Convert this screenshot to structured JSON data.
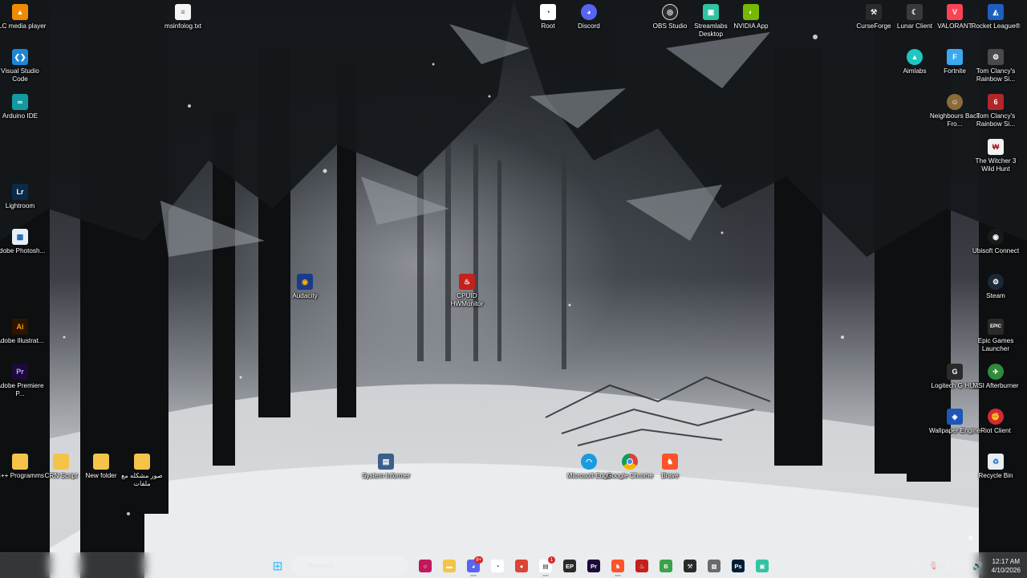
{
  "desktop": {
    "icons": [
      {
        "label": "VLC media player",
        "icon": "vlc-icon",
        "color": "#f08a00",
        "glyph": "▲"
      },
      {
        "label": "Visual Studio Code",
        "icon": "vscode-icon",
        "color": "#1f86d6",
        "glyph": "❮❯"
      },
      {
        "label": "Arduino IDE",
        "icon": "arduino-icon",
        "color": "#129aa0",
        "glyph": "∞"
      },
      {
        "label": "Lightroom",
        "icon": "lightroom-icon",
        "color": "#0b2a4a",
        "glyph": "Lr"
      },
      {
        "label": "Adobe Photosh...",
        "icon": "photoshop-icon",
        "color": "#e8eef5",
        "glyph": "▦"
      },
      {
        "label": "Adobe Illustrat...",
        "icon": "illustrator-icon",
        "color": "#2b1500",
        "glyph": "Ai"
      },
      {
        "label": "Adobe Premiere P...",
        "icon": "premiere-icon",
        "color": "#1b0a3a",
        "glyph": "Pr"
      },
      {
        "label": "C++ Programms",
        "icon": "folder-icon",
        "color": "#f3c449",
        "glyph": ""
      },
      {
        "label": "CRN Script",
        "icon": "folder-icon",
        "color": "#f3c449",
        "glyph": ""
      },
      {
        "label": "New folder",
        "icon": "folder-icon",
        "color": "#f3c449",
        "glyph": ""
      },
      {
        "label": "صور مشكله مع ملفات",
        "icon": "folder-icon",
        "color": "#f3c449",
        "glyph": ""
      },
      {
        "label": "msinfolog.txt",
        "icon": "text-file-icon",
        "color": "#f4f4f4",
        "glyph": "≡"
      },
      {
        "label": "Audacity",
        "icon": "audacity-icon",
        "color": "#1a3a8a",
        "glyph": "◉"
      },
      {
        "label": "CPUID HWMonitor",
        "icon": "hwmonitor-icon",
        "color": "#c4201c",
        "glyph": "♨"
      },
      {
        "label": "System Informer",
        "icon": "system-informer-icon",
        "color": "#3a5f8a",
        "glyph": "▤"
      },
      {
        "label": "Root",
        "icon": "root-icon",
        "color": "#ffffff",
        "glyph": "◔"
      },
      {
        "label": "Discord",
        "icon": "discord-icon",
        "color": "#5865f2",
        "glyph": "◕"
      },
      {
        "label": "OBS Studio",
        "icon": "obs-icon",
        "color": "#2b2b2b",
        "glyph": "◎"
      },
      {
        "label": "Streamlabs Desktop",
        "icon": "streamlabs-icon",
        "color": "#31c3a2",
        "glyph": "▣"
      },
      {
        "label": "NVIDIA App",
        "icon": "nvidia-icon",
        "color": "#76b900",
        "glyph": "◐"
      },
      {
        "label": "Microsoft Edge",
        "icon": "edge-icon",
        "color": "#1a9be0",
        "glyph": "◠"
      },
      {
        "label": "Google Chrome",
        "icon": "chrome-icon",
        "color": "#db4437",
        "glyph": "●"
      },
      {
        "label": "Brave",
        "icon": "brave-icon",
        "color": "#fb542b",
        "glyph": "♞"
      },
      {
        "label": "CurseForge",
        "icon": "curseforge-icon",
        "color": "#2a2a2a",
        "glyph": "⚒"
      },
      {
        "label": "Lunar Client",
        "icon": "lunar-client-icon",
        "color": "#3a3a3a",
        "glyph": "☾"
      },
      {
        "label": "VALORANT",
        "icon": "valorant-icon",
        "color": "#fa4454",
        "glyph": "V"
      },
      {
        "label": "Rocket League®",
        "icon": "rocket-league-icon",
        "color": "#1d5fbf",
        "glyph": "◭"
      },
      {
        "label": "Aimlabs",
        "icon": "aimlabs-icon",
        "color": "#1ec7c0",
        "glyph": "▲"
      },
      {
        "label": "Fortnite",
        "icon": "fortnite-icon",
        "color": "#3aa9f0",
        "glyph": "F"
      },
      {
        "label": "Tom Clancy's Rainbow Si...",
        "icon": "rainbow-six-icon",
        "color": "#4a4a4a",
        "glyph": "⚙"
      },
      {
        "label": "Neighbours Back Fro...",
        "icon": "neighbours-icon",
        "color": "#8a6b3a",
        "glyph": "☺"
      },
      {
        "label": "Tom Clancy's Rainbow Si...",
        "icon": "rainbow-six-icon",
        "color": "#b0262b",
        "glyph": "6"
      },
      {
        "label": "The Witcher 3 Wild Hunt",
        "icon": "witcher-icon",
        "color": "#f2f2f2",
        "glyph": "₩"
      },
      {
        "label": "Ubisoft Connect",
        "icon": "ubisoft-connect-icon",
        "color": "#1a1a1a",
        "glyph": "◉"
      },
      {
        "label": "Steam",
        "icon": "steam-icon",
        "color": "#1b2838",
        "glyph": "⚙"
      },
      {
        "label": "Epic Games Launcher",
        "icon": "epic-games-icon",
        "color": "#2a2a2a",
        "glyph": "EPIC"
      },
      {
        "label": "Logitech G HUB",
        "icon": "logitech-ghub-icon",
        "color": "#2a2a2a",
        "glyph": "G"
      },
      {
        "label": "MSI Afterburner",
        "icon": "msi-afterburner-icon",
        "color": "#2e8b3a",
        "glyph": "✈"
      },
      {
        "label": "Wallpaper Engine",
        "icon": "wallpaper-engine-icon",
        "color": "#1e56b8",
        "glyph": "◈"
      },
      {
        "label": "Riot Client",
        "icon": "riot-client-icon",
        "color": "#d32936",
        "glyph": "✊"
      },
      {
        "label": "Recycle Bin",
        "icon": "recycle-bin-icon",
        "color": "#e6eef4",
        "glyph": "♻"
      }
    ]
  },
  "taskbar": {
    "search_placeholder": "Search",
    "apps": [
      {
        "icon": "windows-start-icon",
        "color": "#4cc2ff",
        "glyph": "⊞",
        "active": false,
        "badge": ""
      },
      {
        "icon": "cortana-ring-icon",
        "color": "#c2185b",
        "glyph": "○",
        "active": false,
        "badge": ""
      },
      {
        "icon": "file-explorer-icon",
        "color": "#f3c449",
        "glyph": "▬",
        "active": false,
        "badge": ""
      },
      {
        "icon": "discord-icon",
        "color": "#5865f2",
        "glyph": "◕",
        "active": true,
        "badge": "9+"
      },
      {
        "icon": "root-icon",
        "color": "#ffffff",
        "glyph": "◔",
        "active": false,
        "badge": ""
      },
      {
        "icon": "chrome-icon",
        "color": "#db4437",
        "glyph": "●",
        "active": false,
        "badge": ""
      },
      {
        "icon": "system-informer-icon",
        "color": "#ffffff",
        "glyph": "▤",
        "active": true,
        "badge": "1"
      },
      {
        "icon": "epic-games-icon",
        "color": "#2a2a2a",
        "glyph": "EP",
        "active": false,
        "badge": ""
      },
      {
        "icon": "premiere-icon",
        "color": "#1b0a3a",
        "glyph": "Pr",
        "active": false,
        "badge": ""
      },
      {
        "icon": "brave-icon",
        "color": "#fb542b",
        "glyph": "♞",
        "active": true,
        "badge": ""
      },
      {
        "icon": "hwmonitor-icon",
        "color": "#c4201c",
        "glyph": "♨",
        "active": false,
        "badge": ""
      },
      {
        "icon": "b-app-icon",
        "color": "#3aa24a",
        "glyph": "B",
        "active": false,
        "badge": ""
      },
      {
        "icon": "curseforge-icon",
        "color": "#2a2a2a",
        "glyph": "⚒",
        "active": false,
        "badge": ""
      },
      {
        "icon": "minecraft-icon",
        "color": "#6b6b6b",
        "glyph": "▩",
        "active": false,
        "badge": ""
      },
      {
        "icon": "photoshop-icon",
        "color": "#001e36",
        "glyph": "Ps",
        "active": false,
        "badge": ""
      },
      {
        "icon": "streamlabs-icon",
        "color": "#31c3a2",
        "glyph": "▣",
        "active": false,
        "badge": ""
      }
    ],
    "tray": {
      "chevron": "^",
      "mic": "🎙",
      "lang": "ع",
      "network": "▭",
      "volume": "🔊",
      "time": "12:17 AM",
      "date": "4/10/2026"
    }
  }
}
